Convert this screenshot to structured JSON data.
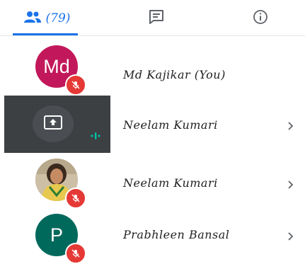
{
  "tabs": {
    "people_count": "(79)"
  },
  "participants": [
    {
      "name": "Md Kajikar (You)",
      "initials": "Md",
      "avatar_color": "#c2185b",
      "muted": true
    },
    {
      "name": "Neelam Kumari",
      "presenting": true
    },
    {
      "name": "Neelam Kumari",
      "muted": true
    },
    {
      "name": "Prabhleen Bansal",
      "initials": "P",
      "avatar_color": "#00695c",
      "muted": true
    }
  ],
  "colors": {
    "accent": "#1a73e8",
    "mute": "#e53935",
    "speaking": "#00bfa5",
    "presenting_tile": "#3c4043"
  }
}
